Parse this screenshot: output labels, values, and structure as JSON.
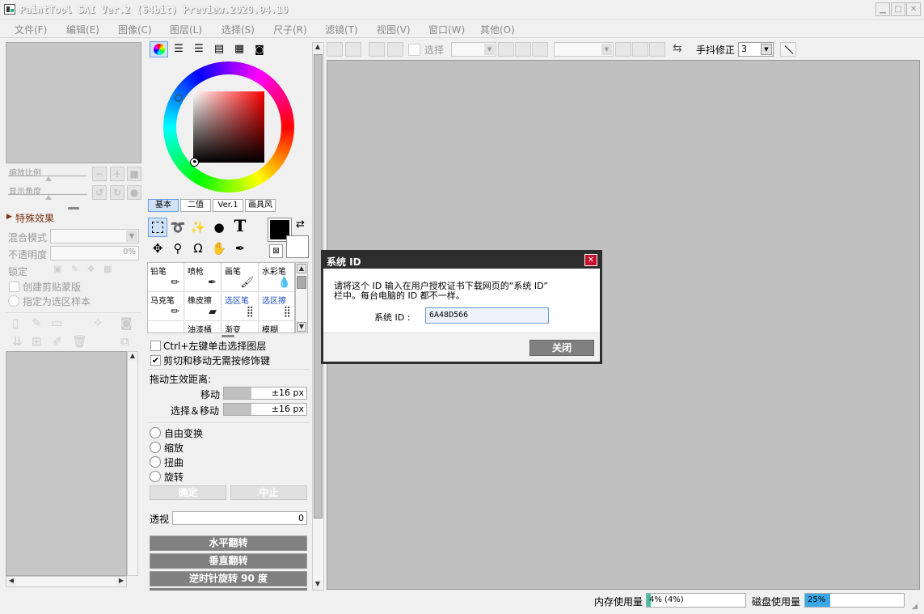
{
  "window": {
    "title": "PaintTool SAI Ver.2 (64bit) Preview.2020.04.10"
  },
  "menu": [
    "文件(F)",
    "编辑(E)",
    "图像(C)",
    "图层(L)",
    "选择(S)",
    "尺子(R)",
    "滤镜(T)",
    "视图(V)",
    "窗口(W)",
    "其他(O)"
  ],
  "left_panel": {
    "zoom_label": "缩放比例",
    "angle_label": "显示角度",
    "effects_label": "特殊效果",
    "blend_mode_label": "混合模式",
    "opacity_label": "不透明度",
    "opacity_value": "0%",
    "lock_label": "锁定",
    "clip_label": "创建剪贴蒙版",
    "selection_source_label": "指定为选区样本"
  },
  "color_panel": {
    "tabs": [
      "基本",
      "二值",
      "Ver.1",
      "画具风"
    ],
    "primary_color": "#000000",
    "secondary_color": "#ffffff"
  },
  "brushes": [
    {
      "label": "铅笔",
      "style": "normal"
    },
    {
      "label": "喷枪",
      "style": "normal"
    },
    {
      "label": "画笔",
      "style": "normal"
    },
    {
      "label": "水彩笔",
      "style": "normal"
    },
    {
      "label": "马克笔",
      "style": "normal"
    },
    {
      "label": "橡皮擦",
      "style": "normal"
    },
    {
      "label": "选区笔",
      "style": "link"
    },
    {
      "label": "选区擦",
      "style": "link"
    },
    {
      "label": "",
      "style": "normal"
    },
    {
      "label": "油漆桶",
      "style": "normal"
    },
    {
      "label": "渐变",
      "style": "normal"
    },
    {
      "label": "模糊",
      "style": "normal"
    }
  ],
  "options_panel": {
    "ctrl_click_label": "Ctrl+左键单击选择图层",
    "cut_move_label": "剪切和移动无需按修饰键",
    "drag_distance_label": "拖动生效距离:",
    "move_label": "移动",
    "move_value": "±16 px",
    "select_move_label": "选择＆移动",
    "select_move_value": "±16 px",
    "transforms": [
      "自由变换",
      "缩放",
      "扭曲",
      "旋转"
    ],
    "confirm_label": "确定",
    "cancel_label": "中止",
    "perspective_label": "透视",
    "perspective_value": "0",
    "flip_h_label": "水平翻转",
    "flip_v_label": "垂直翻转",
    "rotate_ccw_label": "逆时针旋转 90 度"
  },
  "toolbar": {
    "select_label": "选择",
    "stabilizer_label": "手抖修正",
    "stabilizer_value": "3"
  },
  "dialog": {
    "title": "系统 ID",
    "message_line1": "请将这个 ID 输入在用户授权证书下载网页的“系统 ID”",
    "message_line2": "栏中。每台电脑的 ID 都不一样。",
    "id_label": "系统 ID :",
    "id_value": "6A48D566",
    "close_label": "关闭"
  },
  "status": {
    "memory_label": "内存使用量",
    "memory_value": "4% (4%)",
    "memory_fraction": 0.04,
    "disk_label": "磁盘使用量",
    "disk_value": "25%",
    "disk_fraction": 0.25,
    "memory_color": "#40c0a0",
    "disk_color": "#3aa8e8"
  }
}
